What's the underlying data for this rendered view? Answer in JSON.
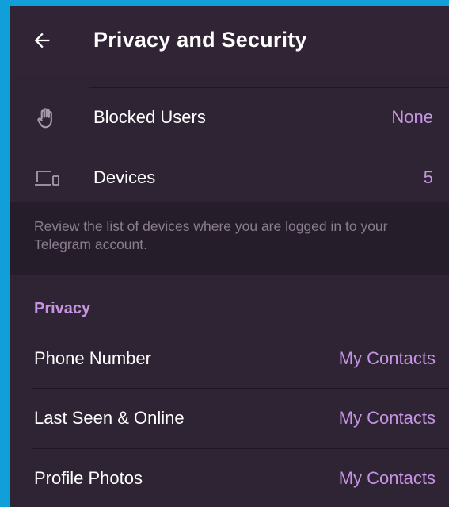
{
  "header": {
    "title": "Privacy and Security"
  },
  "security": {
    "blocked_users": {
      "label": "Blocked Users",
      "value": "None"
    },
    "devices": {
      "label": "Devices",
      "value": "5"
    },
    "hint": "Review the list of devices where you are logged in to your Telegram account."
  },
  "privacy": {
    "title": "Privacy",
    "items": [
      {
        "label": "Phone Number",
        "value": "My Contacts"
      },
      {
        "label": "Last Seen & Online",
        "value": "My Contacts"
      },
      {
        "label": "Profile Photos",
        "value": "My Contacts"
      }
    ]
  },
  "colors": {
    "accent": "#c594e3",
    "background": "#2b2130",
    "frame": "#119fd9"
  },
  "icons": {
    "back": "arrow-left-icon",
    "blocked": "hand-stop-icon",
    "devices": "devices-icon"
  }
}
